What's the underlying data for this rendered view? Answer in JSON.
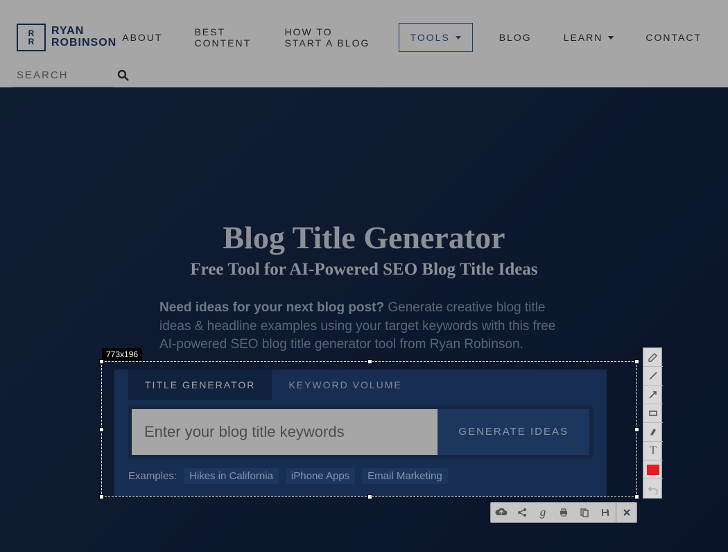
{
  "logo": {
    "mark": "R\nR",
    "text_line1": "RYAN",
    "text_line2": "ROBINSON"
  },
  "nav": {
    "about": "ABOUT",
    "best_content": "BEST CONTENT",
    "how_to_start": "HOW TO START A BLOG",
    "tools": "TOOLS",
    "blog": "BLOG",
    "learn": "LEARN",
    "contact": "CONTACT"
  },
  "search": {
    "placeholder": "SEARCH"
  },
  "hero": {
    "title": "Blog Title Generator",
    "subtitle": "Free Tool for AI-Powered SEO Blog Title Ideas",
    "intro_bold": "Need ideas for your next blog post?",
    "intro_rest": " Generate creative blog title ideas & headline examples using your target keywords with this free AI-powered SEO blog title generator tool from Ryan Robinson."
  },
  "tool": {
    "tab_generator": "TITLE GENERATOR",
    "tab_keyword": "KEYWORD VOLUME",
    "input_placeholder": "Enter your blog title keywords",
    "generate_button": "GENERATE IDEAS",
    "examples_label": "Examples:",
    "example1": "Hikes in California",
    "example2": "iPhone Apps",
    "example3": "Email Marketing"
  },
  "selection": {
    "size_label": "773x196"
  },
  "icons": {
    "search": "search",
    "pencil": "pencil",
    "line": "line",
    "arrow": "arrow",
    "rect": "rect",
    "marker": "marker",
    "text": "T",
    "undo": "undo",
    "cloud": "cloud",
    "share": "share",
    "google": "g",
    "print": "print",
    "copy": "copy",
    "save": "save",
    "close": "×"
  }
}
